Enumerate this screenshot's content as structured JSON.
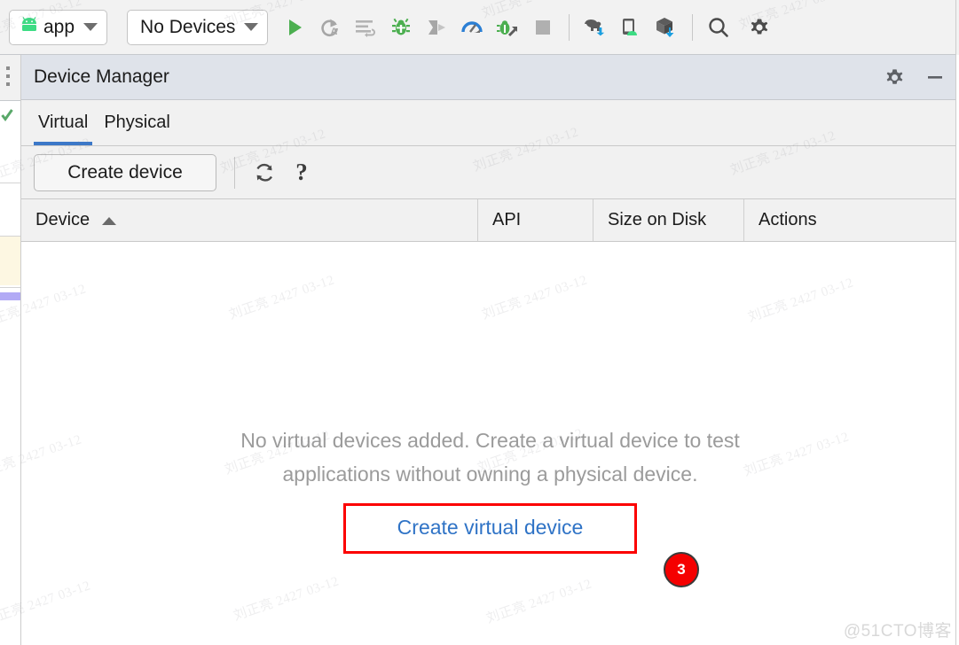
{
  "toolbar": {
    "module_selector": {
      "label": "app",
      "icon": "android-head-icon",
      "caret": "chevron-down-icon"
    },
    "device_selector": {
      "label": "No Devices",
      "caret": "chevron-down-icon"
    },
    "buttons": [
      {
        "name": "run-button",
        "icon": "play-triangle-icon",
        "color": "#4caf50"
      },
      {
        "name": "apply-changes-button",
        "icon": "apply-code-changes-icon",
        "color": "#a6a6a6"
      },
      {
        "name": "run-with-coverage-lines-button",
        "icon": "lines-rerun-icon",
        "color": "#b3b3b3"
      },
      {
        "name": "debug-button",
        "icon": "bug-icon",
        "color": "#4caf50"
      },
      {
        "name": "attach-debugger-button",
        "icon": "attach-debugger-icon",
        "color": "#a6a6a6"
      },
      {
        "name": "profiler-button",
        "icon": "profiler-gauge-icon",
        "color": "#2b7fd4"
      },
      {
        "name": "run-app-inspection-button",
        "icon": "bug-arrow-icon",
        "color": "#4caf50"
      },
      {
        "name": "stop-button",
        "icon": "stop-square-icon",
        "color": "#b0b0b0"
      },
      {
        "name": "gradle-sync-button",
        "icon": "gradle-elephant-sync-icon",
        "color": "#5c5c5c"
      },
      {
        "name": "device-manager-button",
        "icon": "device-android-icon",
        "color": "#5c5c5c"
      },
      {
        "name": "sdk-manager-button",
        "icon": "sdk-box-download-icon",
        "color": "#5c5c5c"
      },
      {
        "name": "search-everywhere-button",
        "icon": "search-magnifier-icon",
        "color": "#4a4a4a"
      },
      {
        "name": "settings-button",
        "icon": "gear-icon",
        "color": "#4a4a4a"
      }
    ]
  },
  "device_manager": {
    "title": "Device Manager",
    "header_actions": [
      {
        "name": "device-manager-settings-button",
        "icon": "gear-icon"
      },
      {
        "name": "minimize-panel-button",
        "icon": "minimize-dash-icon"
      }
    ],
    "tabs": [
      {
        "label": "Virtual",
        "selected": true
      },
      {
        "label": "Physical",
        "selected": false
      }
    ],
    "selected_tab_underline_color": "#3c78c8",
    "actions": {
      "create_device_label": "Create device",
      "refresh_icon": "refresh-circular-arrows-icon",
      "help_label": "?"
    },
    "table": {
      "columns": [
        {
          "label": "Device",
          "sort": "ascending"
        },
        {
          "label": "API",
          "sort": null
        },
        {
          "label": "Size on Disk",
          "sort": null
        },
        {
          "label": "Actions",
          "sort": null
        }
      ],
      "rows": []
    },
    "empty_state": {
      "line1": "No virtual devices added. Create a virtual device to test",
      "line2": "applications without owning a physical device.",
      "cta_label": "Create virtual device",
      "cta_color": "#2f73c6",
      "highlight_border_color": "#fc0000"
    }
  },
  "annotations": {
    "step_badge": {
      "number": "3",
      "background": "#f50000",
      "text_color": "#ffffff"
    }
  },
  "watermark": {
    "text": "刘正亮 2427 03-12",
    "brand": "@51CTO博客"
  },
  "editor_gutter": {
    "more_options_icon": "vertical-dots-icon",
    "inspection_ok_icon": "green-check-icon",
    "warning_stripe_color": "#fdf7e2",
    "marker_color": "#b2aaf5"
  }
}
